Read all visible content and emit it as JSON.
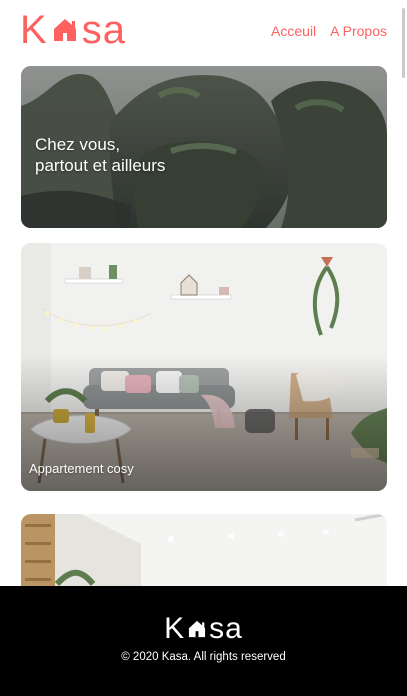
{
  "brand": {
    "logo_left": "K",
    "logo_right": "sa",
    "color": "#ff6060"
  },
  "nav": {
    "items": [
      {
        "label": "Acceuil"
      },
      {
        "label": "A Propos"
      }
    ]
  },
  "banner": {
    "title": "Chez vous,\npartout et ailleurs",
    "image": "rocky-coast-photo"
  },
  "listings": [
    {
      "title": "Appartement cosy",
      "image": "living-room-photo"
    },
    {
      "title": "",
      "image": "apartment-interior-photo"
    }
  ],
  "footer": {
    "logo_left": "K",
    "logo_right": "sa",
    "copyright": "© 2020 Kasa. All rights reserved"
  }
}
